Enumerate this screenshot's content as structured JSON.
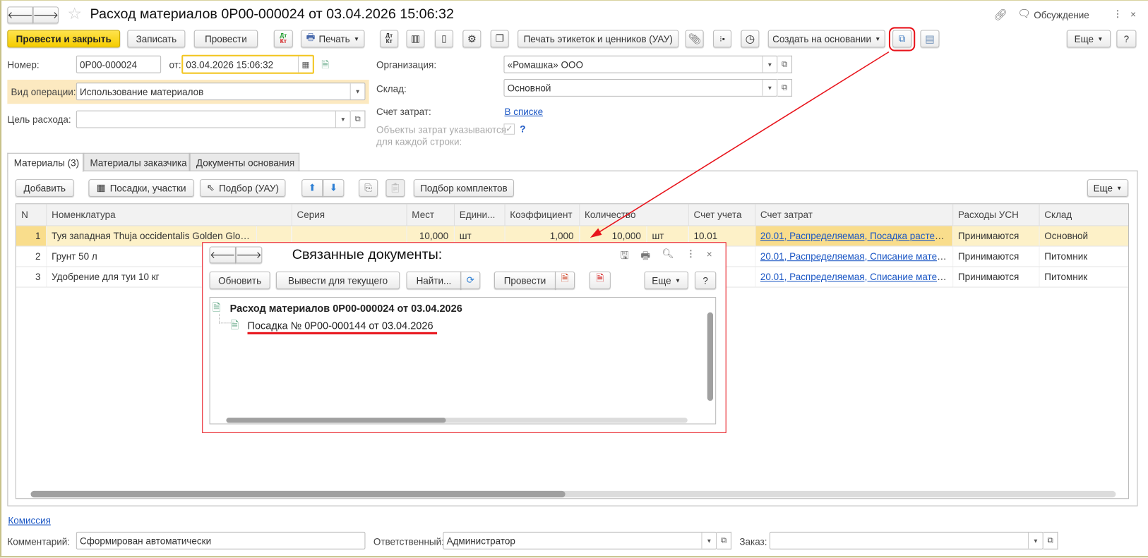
{
  "window": {
    "title": "Расход материалов 0Р00-000024 от 03.04.2026 15:06:32",
    "discussion": "Обсуждение"
  },
  "toolbar": {
    "post_close": "Провести и закрыть",
    "save": "Записать",
    "post": "Провести",
    "print": "Печать",
    "print_labels": "Печать этикеток и ценников (УАУ)",
    "create_based": "Создать на основании",
    "more": "Еще",
    "help": "?",
    "dtkt_dt": "Дт",
    "dtkt_kt": "Кт"
  },
  "header": {
    "number_label": "Номер:",
    "number": "0Р00-000024",
    "date_label": "от:",
    "date": "03.04.2026 15:06:32",
    "op_label": "Вид операции:",
    "op": "Использование материалов",
    "purpose_label": "Цель расхода:",
    "purpose": "",
    "org_label": "Организация:",
    "org": "«Ромашка» ООО",
    "wh_label": "Склад:",
    "wh": "Основной",
    "cost_label": "Счет затрат:",
    "cost_link": "В списке",
    "objects_label_1": "Объекты затрат указываются",
    "objects_label_2": "для каждой строки:",
    "objects_checked": true,
    "help": "?"
  },
  "tabs": [
    {
      "label": "Материалы (3)",
      "active": true
    },
    {
      "label": "Материалы заказчика"
    },
    {
      "label": "Документы основания"
    }
  ],
  "table_toolbar": {
    "add": "Добавить",
    "plantings": "Посадки, участки",
    "pick": "Подбор (УАУ)",
    "kits": "Подбор комплектов",
    "more": "Еще"
  },
  "table": {
    "columns": [
      "N",
      "Номенклатура",
      "Серия",
      "Мест",
      "Едини...",
      "Коэффициент",
      "Количество",
      "Счет учета",
      "Счет затрат",
      "Расходы УСН",
      "Склад"
    ],
    "rows": [
      {
        "n": "1",
        "item": "Туя западная Thuja occidentalis Golden Glob...",
        "series": "",
        "places": "10,000",
        "unit": "шт",
        "coef": "1,000",
        "qty": "10,000",
        "qty_unit": "шт",
        "acc": "10.01",
        "cost": "20.01, Распределяемая, Посадка растен...",
        "usn": "Принимаются",
        "wh": "Основной",
        "selected": true
      },
      {
        "n": "2",
        "item": "Грунт 50 л",
        "series": "",
        "places": "",
        "unit": "",
        "coef": "",
        "qty": "",
        "qty_unit": "",
        "acc": "",
        "cost": "20.01, Распределяемая, Списание матер...",
        "usn": "Принимаются",
        "wh": "Питомник"
      },
      {
        "n": "3",
        "item": "Удобрение для туи 10 кг",
        "series": "",
        "places": "",
        "unit": "",
        "coef": "",
        "qty": "",
        "qty_unit": "",
        "acc": "",
        "cost": "20.01, Распределяемая, Списание матер...",
        "usn": "Принимаются",
        "wh": "Питомник"
      }
    ]
  },
  "popup": {
    "title": "Связанные документы:",
    "refresh": "Обновить",
    "show_current": "Вывести для текущего",
    "find": "Найти...",
    "post": "Провести",
    "more": "Еще",
    "help": "?",
    "tree": [
      {
        "label": "Расход материалов 0Р00-000024 от 03.04.2026",
        "level": 0
      },
      {
        "label": "Посадка № 0Р00-000144 от 03.04.2026",
        "level": 1
      }
    ]
  },
  "footer": {
    "commission": "Комиссия",
    "comment_label": "Комментарий:",
    "comment": "Сформирован автоматически",
    "resp_label": "Ответственный:",
    "resp": "Администратор",
    "order_label": "Заказ:",
    "order": ""
  },
  "colors": {
    "accent_yellow": "#f5cc00",
    "selection": "#fdf1c8",
    "annotation_red": "#e8141c",
    "link": "#1a56c4"
  }
}
